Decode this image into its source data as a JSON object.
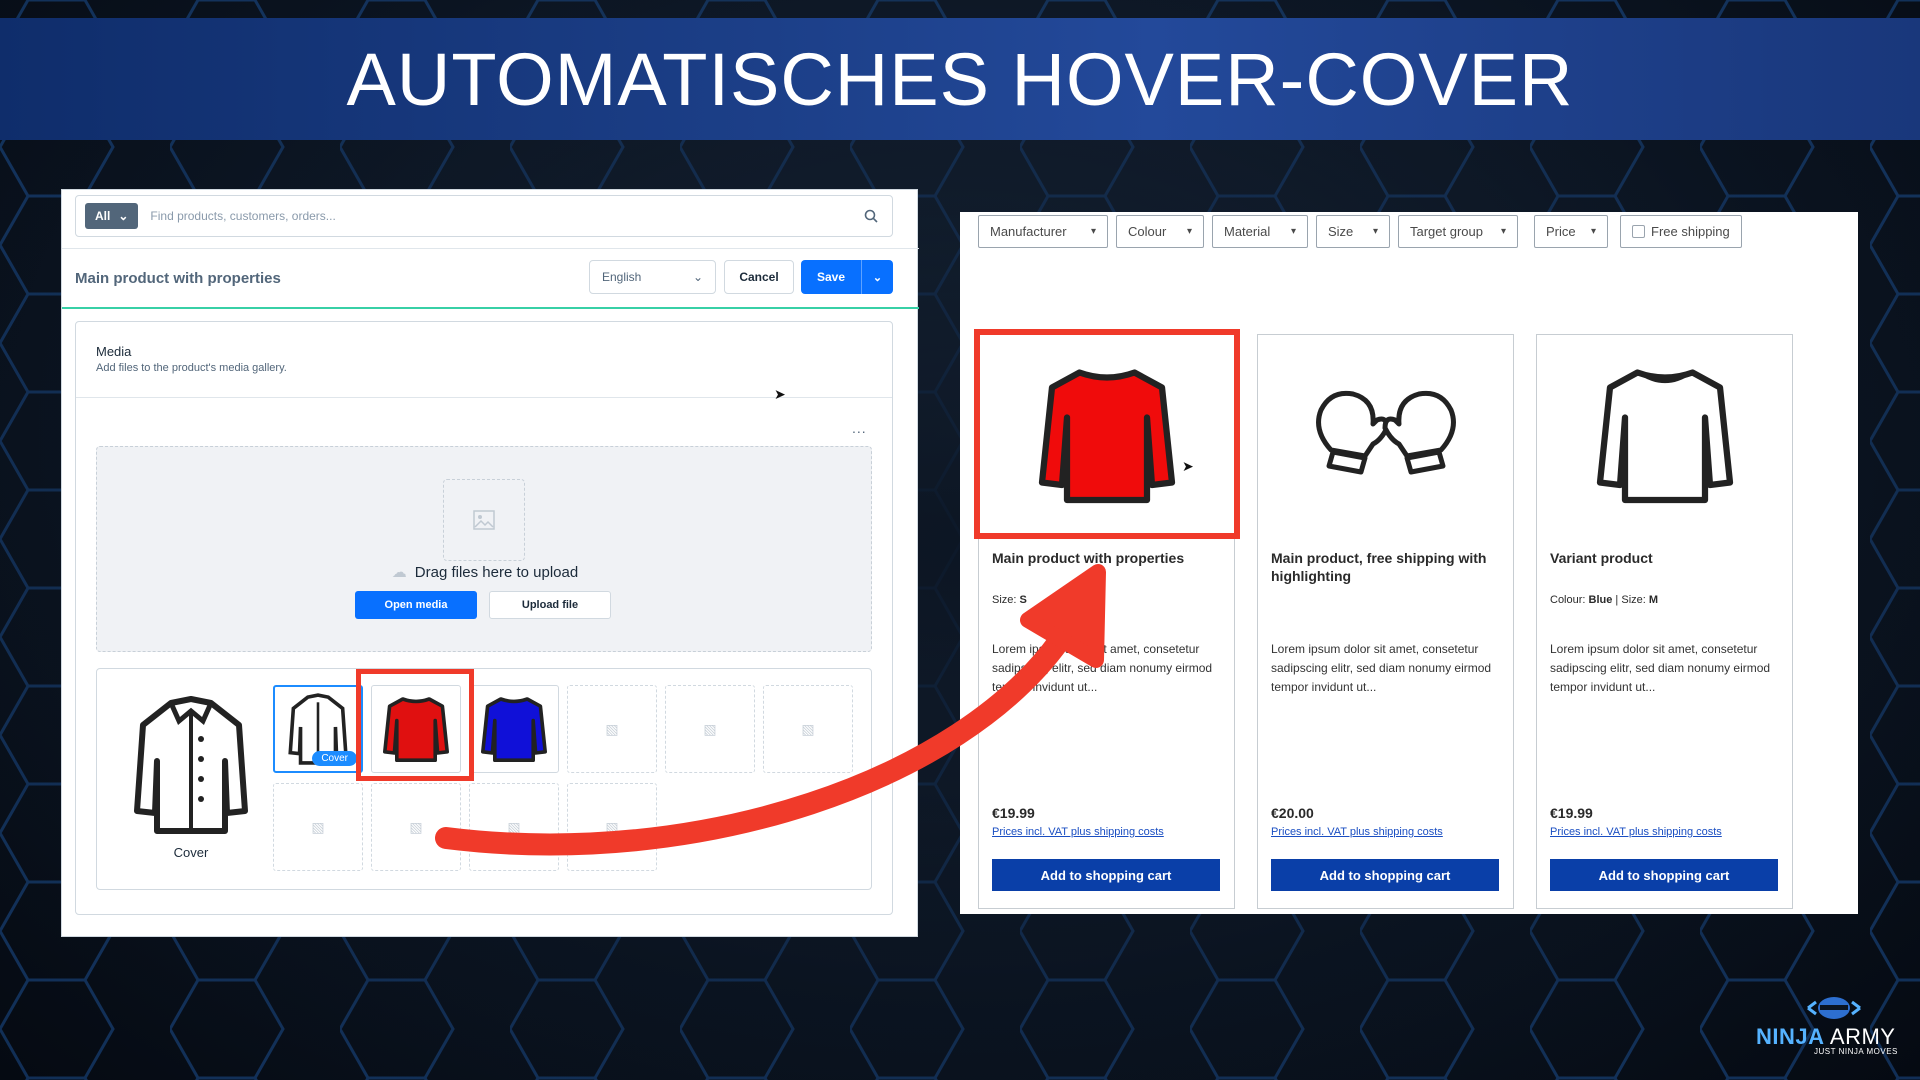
{
  "banner": {
    "title": "AUTOMATISCHES HOVER-COVER"
  },
  "admin": {
    "search": {
      "scope_label": "All",
      "placeholder": "Find products, customers, orders..."
    },
    "product_title": "Main product with properties",
    "language": "English",
    "cancel_label": "Cancel",
    "save_label": "Save",
    "media": {
      "title": "Media",
      "subtitle": "Add files to the product's media gallery.",
      "more": "...",
      "drop_text": "Drag files here to upload",
      "open_media_label": "Open media",
      "upload_label": "Upload file",
      "cover_label": "Cover",
      "cover_badge": "Cover"
    }
  },
  "store": {
    "filters": [
      "Manufacturer",
      "Colour",
      "Material",
      "Size",
      "Target group",
      "Price"
    ],
    "free_shipping_label": "Free shipping",
    "products": [
      {
        "name": "Main product with properties",
        "variant_prefix": "Size: ",
        "variant_value": "S",
        "desc": "Lorem ipsum dolor sit amet, consetetur sadipscing elitr, sed diam nonumy eirmod tempor invidunt ut...",
        "price": "€19.99",
        "vat": "Prices incl. VAT plus shipping costs",
        "cart": "Add to shopping cart",
        "icon": "red-sweater-icon"
      },
      {
        "name": "Main product, free shipping with highlighting",
        "desc": "Lorem ipsum dolor sit amet, consetetur sadipscing elitr, sed diam nonumy eirmod tempor invidunt ut...",
        "price": "€20.00",
        "vat": "Prices incl. VAT plus shipping costs",
        "cart": "Add to shopping cart",
        "icon": "mittens-icon"
      },
      {
        "name": "Variant product",
        "variant_colour_label": "Colour: ",
        "variant_colour": "Blue",
        "variant_size_label": "Size: ",
        "variant_size": "M",
        "desc": "Lorem ipsum dolor sit amet, consetetur sadipscing elitr, sed diam nonumy eirmod tempor invidunt ut...",
        "price": "€19.99",
        "vat": "Prices incl. VAT plus shipping costs",
        "cart": "Add to shopping cart",
        "icon": "sweater-outline-icon"
      }
    ]
  },
  "logo": {
    "ninja": "NINJA",
    "army": " ARMY",
    "tagline": "JUST NINJA MOVES"
  },
  "colors": {
    "highlight": "#f03a2a",
    "primary": "#0870ff",
    "cart": "#0a3fa8",
    "banner": "#1c3f88"
  }
}
